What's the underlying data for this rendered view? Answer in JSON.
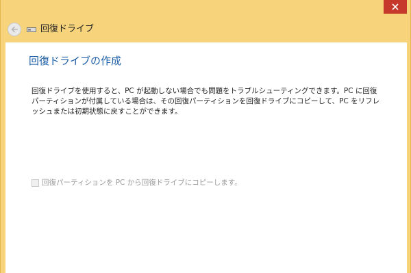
{
  "window": {
    "title": "回復ドライブ",
    "accent_color": "#f7d47c",
    "close_color": "#c7382c"
  },
  "icons": {
    "back": "back-arrow-icon",
    "drive": "drive-icon",
    "close": "close-icon"
  },
  "page": {
    "heading": "回復ドライブの作成",
    "description": "回復ドライブを使用すると、PC が起動しない場合でも問題をトラブルシューティングできます。PC に回復パーティションが付属している場合は、その回復パーティションを回復ドライブにコピーして、PC をリフレッシュまたは初期状態に戻すことができます。",
    "copy_partition_checkbox": {
      "label": "回復パーティションを PC から回復ドライブにコピーします。",
      "checked": false,
      "enabled": false
    }
  }
}
